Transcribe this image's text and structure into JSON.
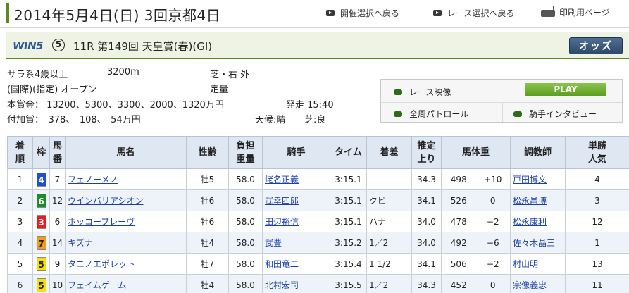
{
  "header": {
    "title": "2014年5月4日(日) 3回京都4日",
    "nav_back_meeting": "開催選択へ戻る",
    "nav_back_race": "レース選択へ戻る",
    "print_page": "印刷用ページ"
  },
  "race": {
    "win5_logo": "WIN5",
    "win5_leg": "⑤",
    "title": "11R 第149回 天皇賞(春)(GI)",
    "odds_button": "オッズ"
  },
  "info": {
    "condition": "サラ系4歳以上",
    "distance": "3200m",
    "course": "芝・右 外",
    "class": "(国際)(指定) オープン",
    "weight_rule": "定量",
    "prize": "本賞金： 13200、5300、3300、2000、1320万円",
    "start_time": "発走 15:40",
    "extra_prize": "付加賞：　378、　108、　54万円",
    "weather": "天候:晴",
    "going": "芝:良"
  },
  "media": {
    "race_video": "レース映像",
    "play": "PLAY",
    "patrol": "全周パトロール",
    "jockey_interview": "騎手インタビュー"
  },
  "table": {
    "headers": [
      "着順",
      "枠",
      "馬番",
      "馬名",
      "性齢",
      "負担重量",
      "騎手",
      "タイム",
      "着差",
      "推定上り",
      "馬体重",
      "調教師",
      "単勝人気"
    ],
    "rows": [
      {
        "rank": "1",
        "waku": "4",
        "waku_bg": "#1e4fd1",
        "waku_fg": "#ffffff",
        "umaban": "7",
        "horse": "フェノーメノ",
        "sexage": "牡5",
        "weight": "58.0",
        "jockey": "蛯名正義",
        "time": "3:15.1",
        "margin": "",
        "agari": "34.3",
        "body": "498",
        "diff": "+10",
        "trainer": "戸田博文",
        "pop": "4"
      },
      {
        "rank": "2",
        "waku": "6",
        "waku_bg": "#1f8a2a",
        "waku_fg": "#ffffff",
        "umaban": "12",
        "horse": "ウインバリアシオン",
        "sexage": "牡6",
        "weight": "58.0",
        "jockey": "武幸四郎",
        "time": "3:15.1",
        "margin": "クビ",
        "agari": "34.1",
        "body": "526",
        "diff": "0",
        "trainer": "松永昌博",
        "pop": "3"
      },
      {
        "rank": "3",
        "waku": "3",
        "waku_bg": "#e02020",
        "waku_fg": "#ffffff",
        "umaban": "6",
        "horse": "ホッコーブレーヴ",
        "sexage": "牡6",
        "weight": "58.0",
        "jockey": "田辺裕信",
        "time": "3:15.1",
        "margin": "ハナ",
        "agari": "34.0",
        "body": "478",
        "diff": "−2",
        "trainer": "松永康利",
        "pop": "12"
      },
      {
        "rank": "4",
        "waku": "7",
        "waku_bg": "#f39a1a",
        "waku_fg": "#222222",
        "umaban": "14",
        "horse": "キズナ",
        "sexage": "牡4",
        "weight": "58.0",
        "jockey": "武豊",
        "time": "3:15.2",
        "margin": "1／2",
        "agari": "34.0",
        "body": "492",
        "diff": "−6",
        "trainer": "佐々木晶三",
        "pop": "1"
      },
      {
        "rank": "5",
        "waku": "5",
        "waku_bg": "#f5e000",
        "waku_fg": "#222222",
        "umaban": "9",
        "horse": "タニノエポレット",
        "sexage": "牡7",
        "weight": "58.0",
        "jockey": "和田竜二",
        "time": "3:15.4",
        "margin": "1 1/2",
        "agari": "34.1",
        "body": "506",
        "diff": "−2",
        "trainer": "村山明",
        "pop": "13"
      },
      {
        "rank": "6",
        "waku": "5",
        "waku_bg": "#f5e000",
        "waku_fg": "#222222",
        "umaban": "10",
        "horse": "フェイムゲーム",
        "sexage": "牡4",
        "weight": "58.0",
        "jockey": "北村宏司",
        "time": "3:15.5",
        "margin": "1／2",
        "agari": "34.3",
        "body": "452",
        "diff": "0",
        "trainer": "宗像義忠",
        "pop": "11"
      }
    ]
  }
}
